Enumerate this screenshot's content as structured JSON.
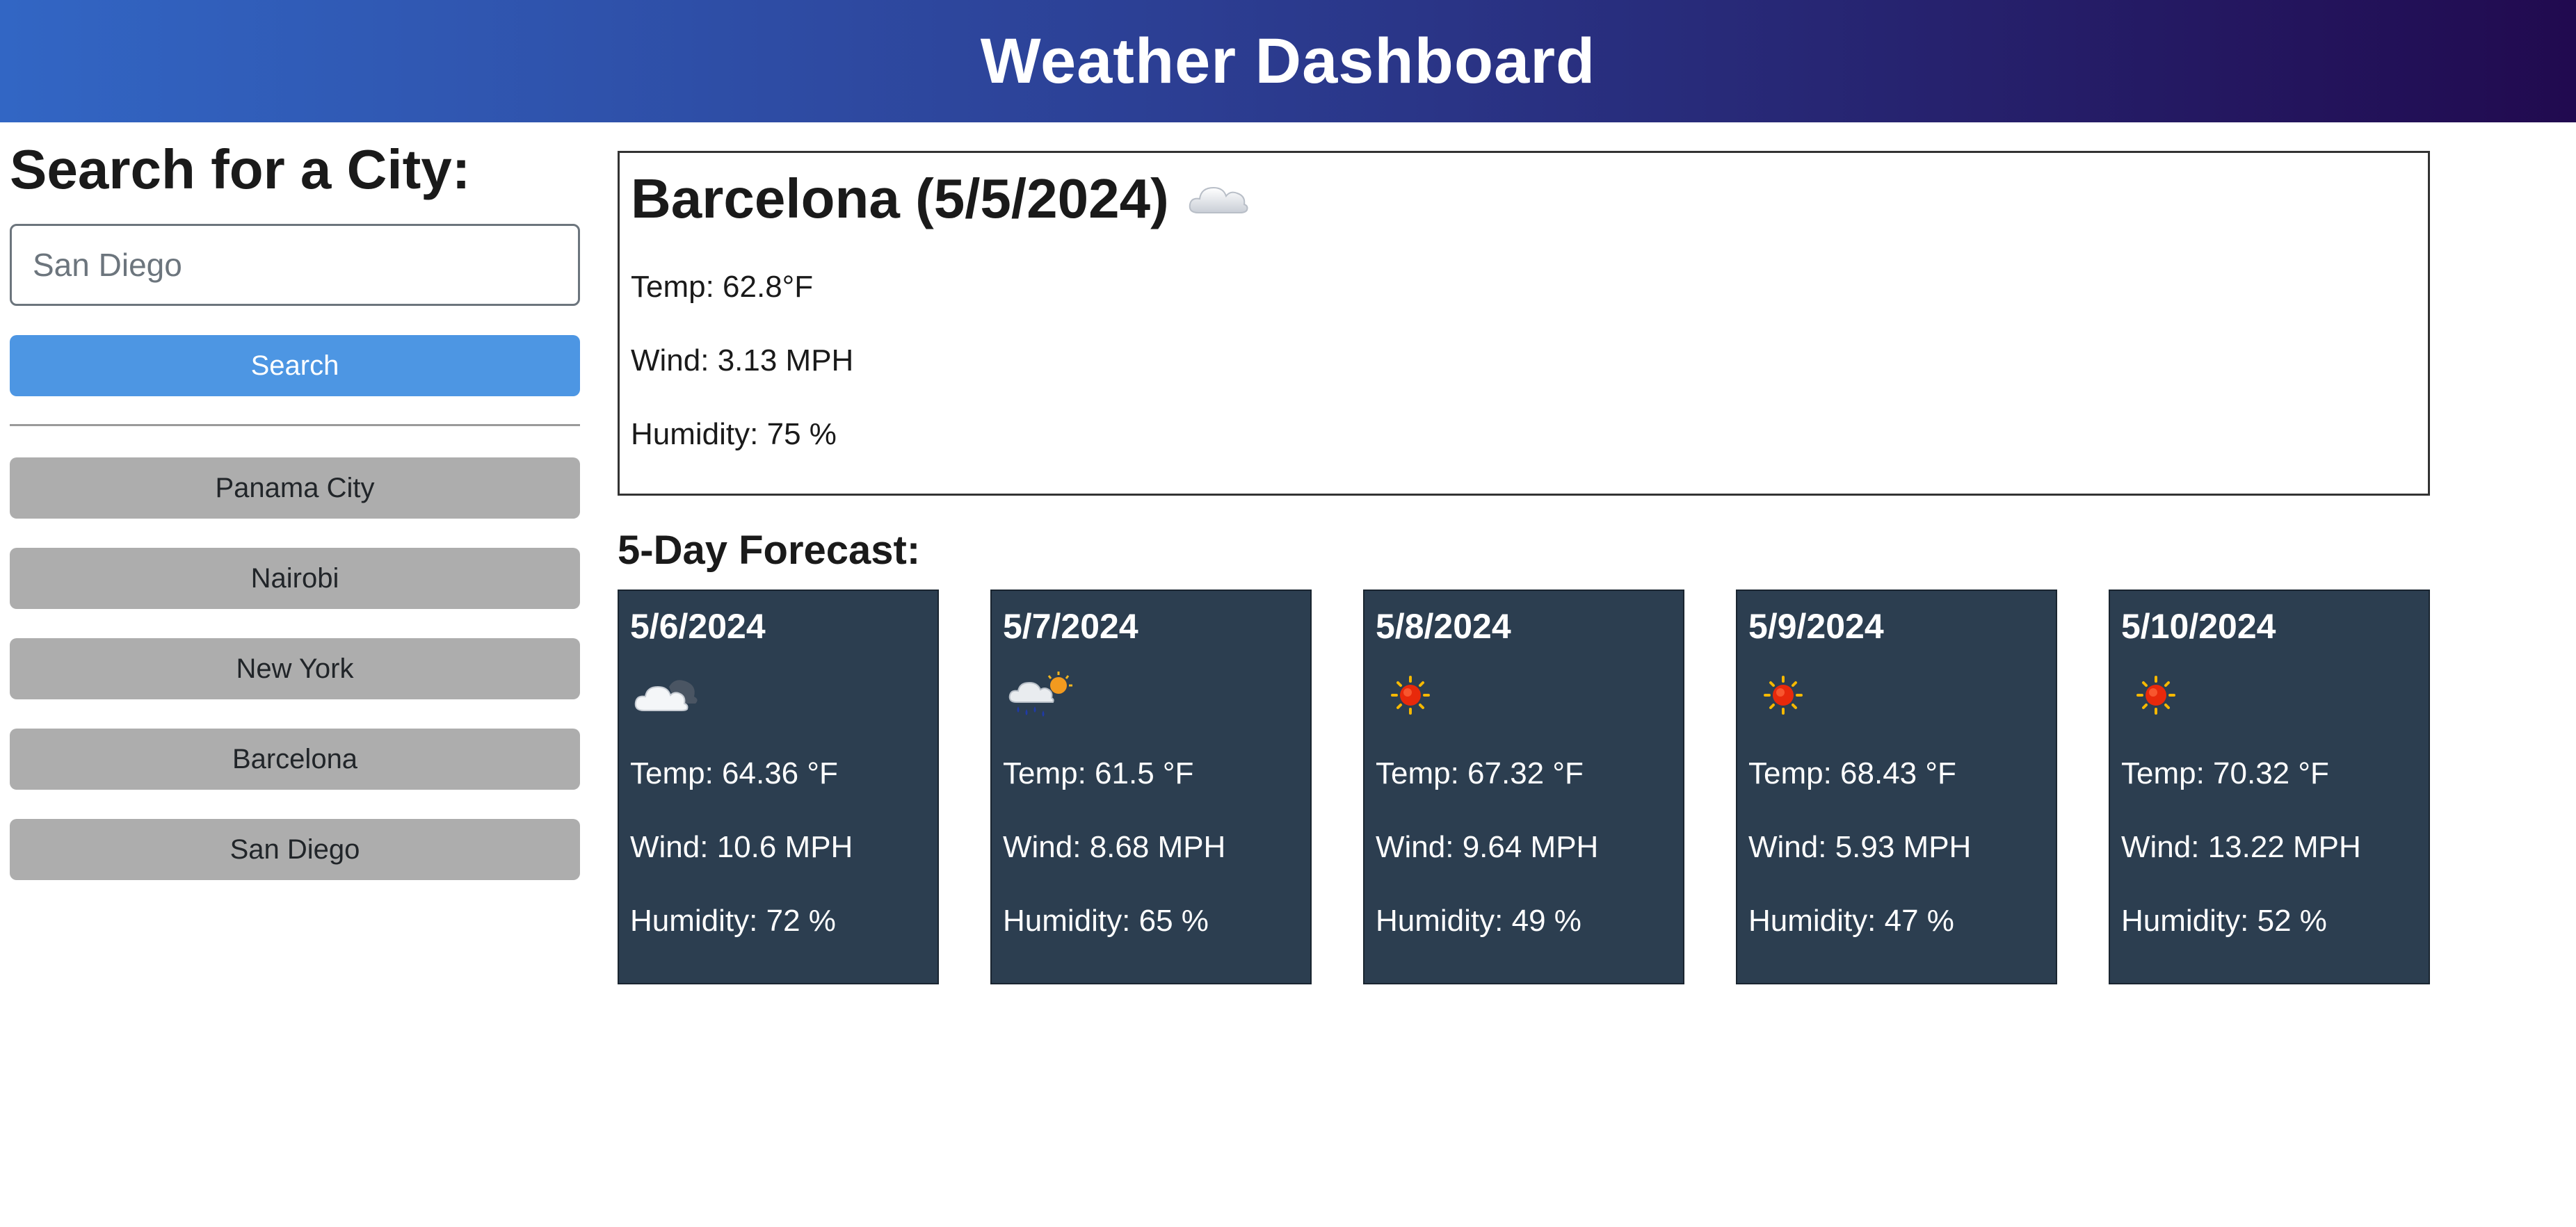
{
  "header": {
    "title": "Weather Dashboard"
  },
  "sidebar": {
    "heading": "Search for a City:",
    "search_placeholder": "San Diego",
    "search_button": "Search",
    "history": [
      "Panama City",
      "Nairobi",
      "New York",
      "Barcelona",
      "San Diego"
    ]
  },
  "current": {
    "title": "Barcelona (5/5/2024)",
    "icon": "cloud-icon",
    "temp": "Temp: 62.8°F",
    "wind": "Wind: 3.13 MPH",
    "humidity": "Humidity: 75 %"
  },
  "forecast": {
    "title": "5-Day Forecast:",
    "days": [
      {
        "date": "5/6/2024",
        "icon": "partly-cloudy-icon",
        "temp": "Temp: 64.36 °F",
        "wind": "Wind: 10.6 MPH",
        "humidity": "Humidity: 72 %"
      },
      {
        "date": "5/7/2024",
        "icon": "rain-sun-icon",
        "temp": "Temp: 61.5 °F",
        "wind": "Wind: 8.68 MPH",
        "humidity": "Humidity: 65 %"
      },
      {
        "date": "5/8/2024",
        "icon": "sun-icon",
        "temp": "Temp: 67.32 °F",
        "wind": "Wind: 9.64 MPH",
        "humidity": "Humidity: 49 %"
      },
      {
        "date": "5/9/2024",
        "icon": "sun-icon",
        "temp": "Temp: 68.43 °F",
        "wind": "Wind: 5.93 MPH",
        "humidity": "Humidity: 47 %"
      },
      {
        "date": "5/10/2024",
        "icon": "sun-icon",
        "temp": "Temp: 70.32 °F",
        "wind": "Wind: 13.22 MPH",
        "humidity": "Humidity: 52 %"
      }
    ]
  },
  "colors": {
    "header_gradient": [
      "#3266c4",
      "#2c3f94",
      "#210a4f"
    ],
    "search_button": "#4d96e3",
    "history_button": "#adadad",
    "card_background": "#2c3e50"
  }
}
